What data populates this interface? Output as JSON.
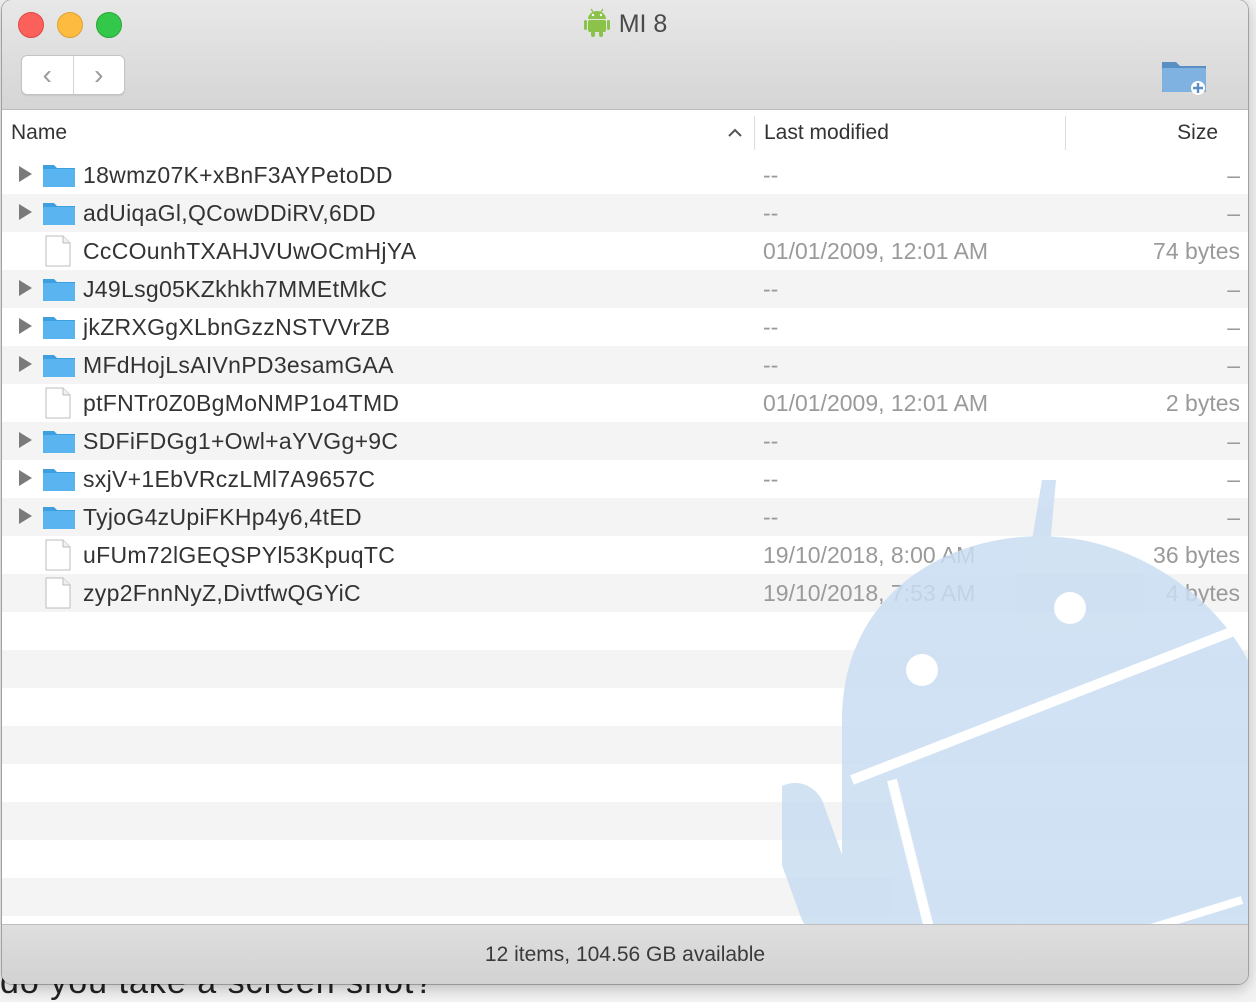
{
  "background_text": "do you take a screen shot?",
  "window": {
    "title": "MI 8",
    "title_icon": "android-icon",
    "nav": {
      "back_icon": "chevron-left-icon",
      "forward_icon": "chevron-right-icon",
      "back_glyph": "‹",
      "forward_glyph": "›"
    },
    "new_folder_icon": "new-folder-icon"
  },
  "columns": {
    "name": "Name",
    "modified": "Last modified",
    "size": "Size",
    "sort": "ascending"
  },
  "files": [
    {
      "name": "18wmz07K+xBnF3AYPetoDD",
      "type": "folder",
      "modified": "--",
      "size": "–"
    },
    {
      "name": "adUiqaGl,QCowDDiRV,6DD",
      "type": "folder",
      "modified": "--",
      "size": "–"
    },
    {
      "name": "CcCOunhTXAHJVUwOCmHjYA",
      "type": "file",
      "modified": "01/01/2009, 12:01 AM",
      "size": "74 bytes"
    },
    {
      "name": "J49Lsg05KZkhkh7MMEtMkC",
      "type": "folder",
      "modified": "--",
      "size": "–"
    },
    {
      "name": "jkZRXGgXLbnGzzNSTVVrZB",
      "type": "folder",
      "modified": "--",
      "size": "–"
    },
    {
      "name": "MFdHojLsAIVnPD3esamGAA",
      "type": "folder",
      "modified": "--",
      "size": "–"
    },
    {
      "name": "ptFNTr0Z0BgMoNMP1o4TMD",
      "type": "file",
      "modified": "01/01/2009, 12:01 AM",
      "size": "2 bytes"
    },
    {
      "name": "SDFiFDGg1+Owl+aYVGg+9C",
      "type": "folder",
      "modified": "--",
      "size": "–"
    },
    {
      "name": "sxjV+1EbVRczLMl7A9657C",
      "type": "folder",
      "modified": "--",
      "size": "–"
    },
    {
      "name": "TyjoG4zUpiFKHp4y6,4tED",
      "type": "folder",
      "modified": "--",
      "size": "–"
    },
    {
      "name": "uFUm72lGEQSPYl53KpuqTC",
      "type": "file",
      "modified": "19/10/2018, 8:00 AM",
      "size": "36 bytes"
    },
    {
      "name": "zyp2FnnNyZ,DivtfwQGYiC",
      "type": "file",
      "modified": "19/10/2018, 7:53 AM",
      "size": "4 bytes"
    }
  ],
  "status": "12 items, 104.56 GB available",
  "colors": {
    "folder": "#5ab4ef",
    "folder_dark": "#3e9fe0",
    "watermark": "#c9ddf2"
  }
}
